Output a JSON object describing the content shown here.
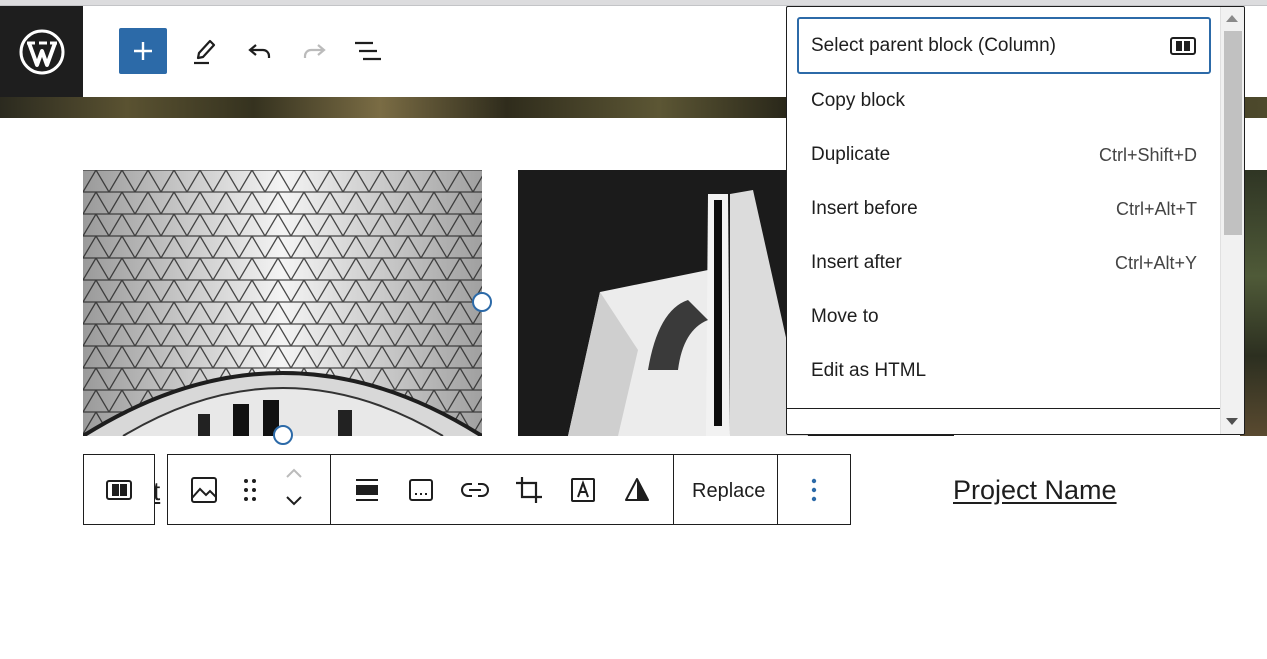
{
  "topbar": {
    "logo_icon": "wordpress-logo",
    "add_block_icon": "plus-icon",
    "tools": [
      "pencil-icon",
      "undo-icon",
      "redo-icon",
      "list-view-icon"
    ]
  },
  "content": {
    "caption_partial": "ct",
    "project_name": "Project Name"
  },
  "block_toolbar": {
    "icons": [
      "column-icon",
      "image-icon",
      "drag-handle-icon",
      "move-up-icon",
      "move-down-icon",
      "align-icon",
      "caption-icon",
      "link-icon",
      "crop-icon",
      "text-overlay-icon",
      "duotone-icon",
      "more-options-icon"
    ],
    "replace_label": "Replace"
  },
  "dropdown": {
    "items": [
      {
        "label": "Select parent block (Column)",
        "shortcut": ""
      },
      {
        "label": "Copy block",
        "shortcut": ""
      },
      {
        "label": "Duplicate",
        "shortcut": "Ctrl+Shift+D"
      },
      {
        "label": "Insert before",
        "shortcut": "Ctrl+Alt+T"
      },
      {
        "label": "Insert after",
        "shortcut": "Ctrl+Alt+Y"
      },
      {
        "label": "Move to",
        "shortcut": ""
      },
      {
        "label": "Edit as HTML",
        "shortcut": ""
      }
    ]
  },
  "colors": {
    "accent": "#2c6aa8",
    "dark": "#1e1e1e"
  }
}
